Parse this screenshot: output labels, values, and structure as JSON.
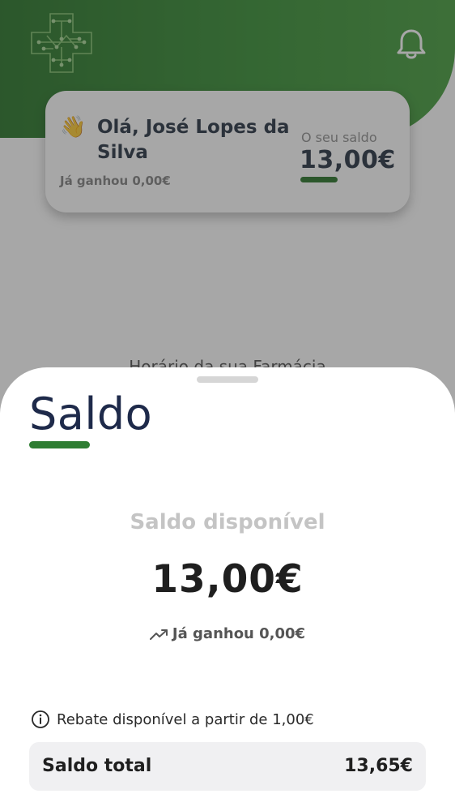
{
  "header": {
    "logo_icon": "pharmacy-cross-logo-icon",
    "notifications_icon": "bell-icon",
    "brand_color": "#2f8a2c"
  },
  "greeting_card": {
    "wave_icon": "waving-hand-icon",
    "greeting": "Olá, José Lopes da Silva",
    "earned": "Já ganhou 0,00€",
    "balance_label": "O seu saldo",
    "balance_value": "13,00€"
  },
  "behind_sheet_text": "Horário da sua Farmácia",
  "sheet": {
    "title": "Saldo",
    "available_label": "Saldo disponível",
    "available_value": "13,00€",
    "earned_icon": "trending-up-icon",
    "earned_text": "Já ganhou 0,00€",
    "info_icon": "info-icon",
    "rebate_text": "Rebate disponível a partir de 1,00€",
    "total_label": "Saldo total",
    "total_value": "13,65€"
  }
}
